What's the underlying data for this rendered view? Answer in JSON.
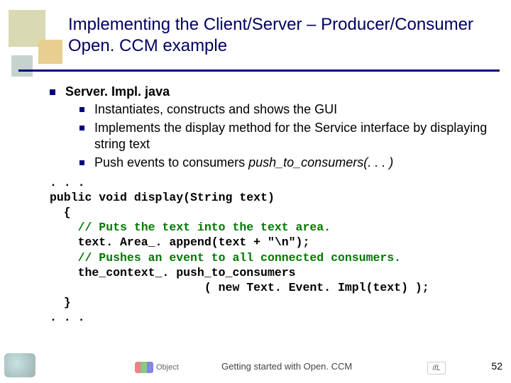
{
  "title": "Implementing the Client/Server – Producer/Consumer Open. CCM example",
  "bullets": {
    "heading": "Server. Impl. java",
    "items": [
      "Instantiates, constructs and shows the GUI",
      "Implements the display method for the Service interface by displaying string text"
    ],
    "push_prefix": "Push events to consumers ",
    "push_call": "push_to_consumers(. . . )"
  },
  "code": {
    "l0": ". . .",
    "l1": "public void display(String text)",
    "l2": "  {",
    "l3": "    // Puts the text into the text area.",
    "l4": "    text. Area_. append(text + \"\\n\");",
    "l5": "    // Pushes an event to all connected consumers.",
    "l6": "    the_context_. push_to_consumers",
    "l7": "                      ( new Text. Event. Impl(text) );",
    "l8": "  }",
    "l9": ". . ."
  },
  "footer": {
    "center_brand": "Object",
    "text": "Getting started with Open. CCM",
    "right_mark": "ifL"
  },
  "page_number": "52"
}
